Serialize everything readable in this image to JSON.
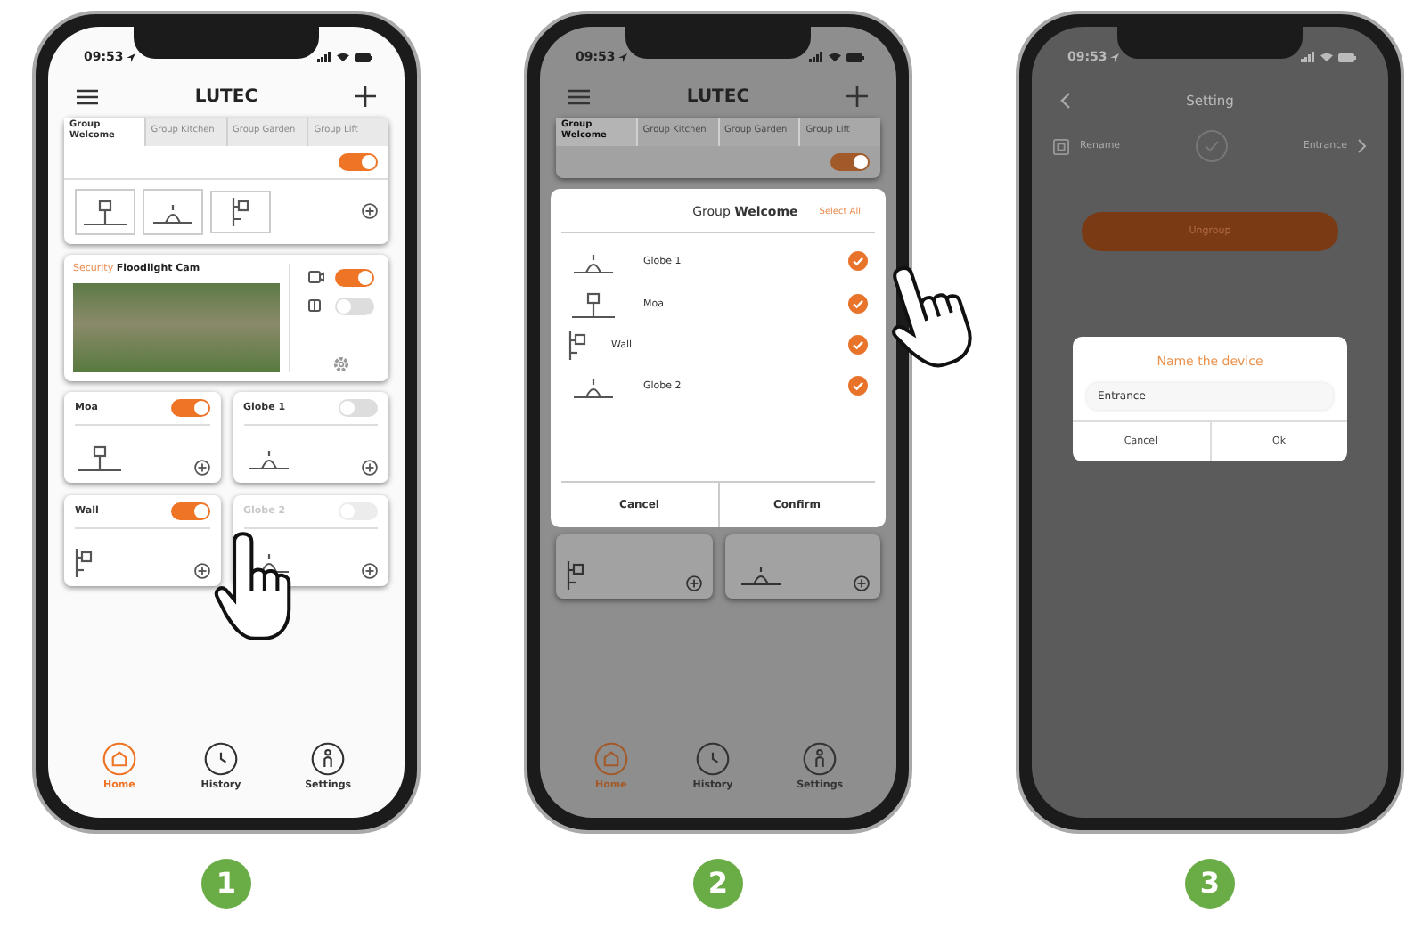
{
  "screen_1": {
    "status_time": "09:53",
    "title": "LUTEC",
    "group_tabs": [
      {
        "label": "Group Welcome",
        "selected": true
      },
      {
        "label": "Group Kitchen",
        "selected": false
      },
      {
        "label": "Group Garden",
        "selected": false
      },
      {
        "label": "Group Lift",
        "selected": false
      }
    ],
    "group_on": true,
    "group_fixtures": [
      {
        "kind": "post"
      },
      {
        "kind": "globe"
      },
      {
        "kind": "wall"
      }
    ],
    "camera": {
      "tag": "Security",
      "name": "Floodlight Cam",
      "camera_on": true,
      "light_on": false
    },
    "devices": [
      {
        "name": "Moa",
        "kind": "post",
        "on": true,
        "disabled": false
      },
      {
        "name": "Globe 1",
        "kind": "globe",
        "on": false,
        "disabled": false
      },
      {
        "name": "Wall",
        "kind": "wall",
        "on": true,
        "disabled": false
      },
      {
        "name": "Globe 2",
        "kind": "globe",
        "on": false,
        "disabled": true
      }
    ],
    "nav": [
      {
        "label": "Home",
        "kind": "home",
        "selected": true
      },
      {
        "label": "History",
        "kind": "history",
        "selected": false
      },
      {
        "label": "Settings",
        "kind": "settings",
        "selected": false
      }
    ]
  },
  "screen_2": {
    "status_time": "09:53",
    "title": "LUTEC",
    "group_tabs": [
      {
        "label": "Group Welcome",
        "selected": true
      },
      {
        "label": "Group Kitchen",
        "selected": false
      },
      {
        "label": "Group Garden",
        "selected": false
      },
      {
        "label": "Group Lift",
        "selected": false
      }
    ],
    "group_on": true,
    "dialog": {
      "title": "Group **Welcome**",
      "select_all": "Select All",
      "items": [
        {
          "name": "Globe 1",
          "kind": "globe",
          "checked": true
        },
        {
          "name": "Moa",
          "kind": "post",
          "checked": true
        },
        {
          "name": "Wall",
          "kind": "wall",
          "checked": true
        },
        {
          "name": "Globe 2",
          "kind": "globe",
          "checked": true
        }
      ],
      "buttons": [
        "Cancel",
        "Confirm"
      ]
    },
    "below_cards": [
      {
        "kind": "wall"
      },
      {
        "kind": "globe"
      }
    ],
    "nav": [
      {
        "label": "Home",
        "kind": "home",
        "selected": true
      },
      {
        "label": "History",
        "kind": "history",
        "selected": false
      },
      {
        "label": "Settings",
        "kind": "settings",
        "selected": false
      }
    ]
  },
  "screen_3": {
    "status_time": "09:53",
    "title": "Setting",
    "rename_label": "Rename",
    "rename_value": "Entrance",
    "ungroup": "Ungroup",
    "dialog": {
      "title": "Name the device",
      "value": "Entrance",
      "buttons": [
        "Cancel",
        "Ok"
      ]
    }
  },
  "steps": [
    "1",
    "2",
    "3"
  ]
}
